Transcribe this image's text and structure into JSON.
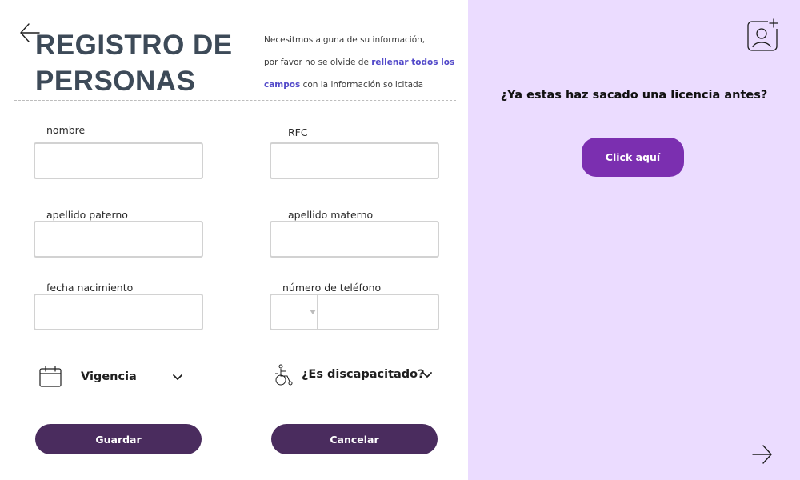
{
  "colors": {
    "title": "#3d4a58",
    "highlight": "#5249c9",
    "button_dark": "#4a2c5e",
    "accent_button": "#7b2fb0",
    "right_panel_bg": "#ebdcff",
    "input_border": "#d2d2d2"
  },
  "header": {
    "back_icon": "arrow-left-icon",
    "title_line1": "REGISTRO DE",
    "title_line2": "PERSONAS",
    "intro_part1": "Necesitmos alguna de su información,",
    "intro_part2": "por favor no se olvide de ",
    "intro_highlight1": "rellenar todos los",
    "intro_highlight2": "campos",
    "intro_part3": " con la información solicitada"
  },
  "form": {
    "nombre": {
      "label": "nombre",
      "value": "",
      "placeholder": ""
    },
    "rfc": {
      "label": "RFC",
      "value": "",
      "placeholder": ""
    },
    "apellido_paterno": {
      "label": "apellido paterno",
      "value": "",
      "placeholder": ""
    },
    "apellido_materno": {
      "label": "apellido materno",
      "value": "",
      "placeholder": ""
    },
    "fecha_nacimiento": {
      "label": "fecha nacimiento",
      "value": "",
      "placeholder": ""
    },
    "telefono": {
      "label": "número de teléfono",
      "code": "",
      "value": "",
      "placeholder": ""
    },
    "vigencia": {
      "label": "Vigencia",
      "icon": "calendar-icon",
      "chevron": "chevron-down-icon"
    },
    "discapacitado": {
      "label": "¿Es discapacitado?",
      "icon": "wheelchair-icon",
      "chevron": "chevron-down-icon"
    },
    "guardar_label": "Guardar",
    "cancelar_label": "Cancelar"
  },
  "side_panel": {
    "add_user_icon": "add-user-icon",
    "question": "¿Ya estas haz sacado una licencia antes?",
    "click_label": "Click aquí",
    "next_icon": "arrow-right-icon"
  }
}
